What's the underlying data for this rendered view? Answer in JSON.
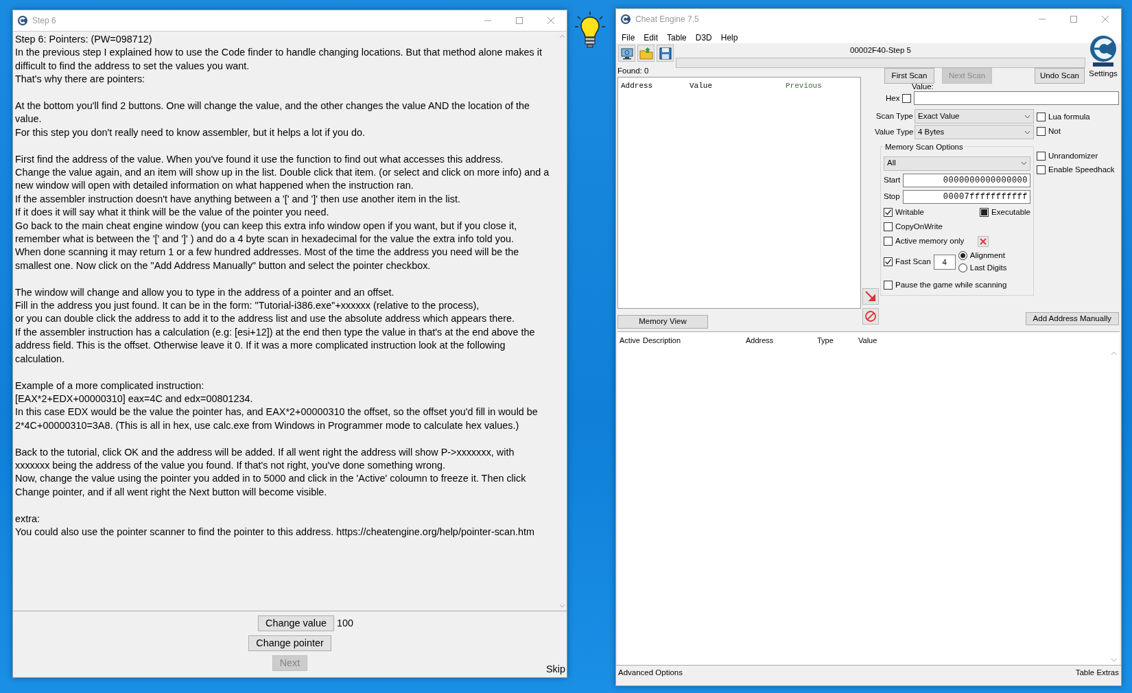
{
  "tutorial_window": {
    "title": "Step 6",
    "blocks": [
      {
        "lines": [
          "Step 6: Pointers: (PW=098712)",
          "In the previous step I explained how to use the Code finder to handle changing locations. But that method alone makes it difficult to find the address to set the values you want.",
          "That's why there are pointers:"
        ]
      },
      {
        "lines": [
          "At the bottom you'll find 2 buttons. One will change the value, and the other changes the value AND the location of the value.",
          "For this step you don't really need to know assembler, but it helps a lot if you do."
        ]
      },
      {
        "lines": [
          "First find the address of the value. When you've found it use the function to find out what accesses this address.",
          "Change the value again, and an item will show up in the list. Double click that item. (or select and click on more info) and a new window will open with detailed information on what happened when the instruction ran.",
          "If the assembler instruction doesn't have anything between a '[' and ']' then use another item in the list.",
          "If it does it will say what it think will be the value of the pointer you need.",
          "Go back to the main cheat engine window (you can keep this extra info window open if you want, but if you close it, remember what is between the '[' and ']' ) and do a 4 byte scan in hexadecimal for the value the extra info told you.",
          "When done scanning it may return 1 or a few hundred addresses. Most of the time the address you need will be the smallest one. Now click on the \"Add Address Manually\" button and select the pointer checkbox."
        ]
      },
      {
        "lines": [
          "The window will change and allow you to type in the address of a pointer and an offset.",
          "Fill in the address you just found. It can be in the form: \"Tutorial-i386.exe\"+xxxxxx (relative to the process),",
          "or you can double click the address to add it to the address list and use the absolute address which appears there.",
          "If the assembler instruction has a calculation (e.g: [esi+12]) at the end then type the value in that's at the end above the address field. This is the offset. Otherwise leave it 0. If it was a more complicated instruction look at the following calculation."
        ]
      },
      {
        "lines": [
          "Example of a more complicated instruction:",
          "[EAX*2+EDX+00000310] eax=4C and edx=00801234.",
          "In this case EDX would be the value the pointer has, and EAX*2+00000310 the offset, so the offset you'd fill in would be 2*4C+00000310=3A8.  (This is all in hex, use calc.exe from Windows in Programmer mode to calculate hex values.)"
        ]
      },
      {
        "lines": [
          "Back to the tutorial, click OK and the address will be added. If all went right the address will show P->xxxxxxx, with xxxxxxx being the address of the value you found. If that's not right, you've done something wrong.",
          "Now, change the value using the pointer you added in to 5000 and click in the 'Active' coloumn to freeze it. Then click Change pointer, and if all went right the Next button will become visible."
        ]
      },
      {
        "lines": [
          "extra:",
          "You could also use the pointer scanner to find the pointer to this address. https://cheatengine.org/help/pointer-scan.htm"
        ]
      }
    ],
    "change_value_button": "Change value",
    "current_value": "100",
    "change_pointer_button": "Change pointer",
    "next_button": {
      "label": "Next",
      "disabled": true
    },
    "skip_link": "Skip"
  },
  "main_window": {
    "title": "Cheat Engine 7.5",
    "menu": [
      "File",
      "Edit",
      "Table",
      "D3D",
      "Help"
    ],
    "process": "00002F40-Step 5",
    "progress": {
      "level": 0
    },
    "found": "Found: 0",
    "settings_label": "Settings",
    "scan_results": {
      "columns": [
        "Address",
        "Value",
        "Previous"
      ]
    },
    "scan_buttons": [
      {
        "label": "First Scan",
        "disabled": false
      },
      {
        "label": "Next Scan",
        "disabled": true
      },
      {
        "label": "Undo Scan",
        "disabled": false
      }
    ],
    "value_label": "Value:",
    "hex": {
      "label": "Hex",
      "checked": false
    },
    "scan_type": {
      "label": "Scan Type",
      "value": "Exact Value"
    },
    "value_type": {
      "label": "Value Type",
      "value": "4 Bytes"
    },
    "side_options": [
      {
        "label": "Lua formula",
        "checked": false
      },
      {
        "label": "Not",
        "checked": false
      },
      {
        "label": "Unrandomizer",
        "checked": false
      },
      {
        "label": "Enable Speedhack",
        "checked": false
      }
    ],
    "memory_scan_options": {
      "title": "Memory Scan Options",
      "region": "All",
      "start": {
        "label": "Start",
        "value": "0000000000000000"
      },
      "stop": {
        "label": "Stop",
        "value": "00007fffffffffff"
      },
      "flags": [
        {
          "label": "Writable",
          "checked": true,
          "indeterminate": false
        },
        {
          "label": "Executable",
          "checked": false,
          "indeterminate": true
        },
        {
          "label": "CopyOnWrite",
          "checked": false,
          "indeterminate": false
        },
        {
          "label": "Active memory only",
          "checked": false,
          "indeterminate": false
        }
      ],
      "fast_scan": {
        "label": "Fast Scan",
        "checked": true,
        "value": "4"
      },
      "alignment_options": [
        {
          "label": "Alignment",
          "selected": true
        },
        {
          "label": "Last Digits",
          "selected": false
        }
      ],
      "pause": {
        "label": "Pause the game while scanning",
        "checked": false
      }
    },
    "memory_view_button": "Memory View",
    "add_address_button": "Add Address Manually",
    "address_table": {
      "columns": [
        "Active",
        "Description",
        "Address",
        "Type",
        "Value"
      ]
    },
    "status_bar": {
      "left": "Advanced Options",
      "right": "Table Extras"
    }
  }
}
